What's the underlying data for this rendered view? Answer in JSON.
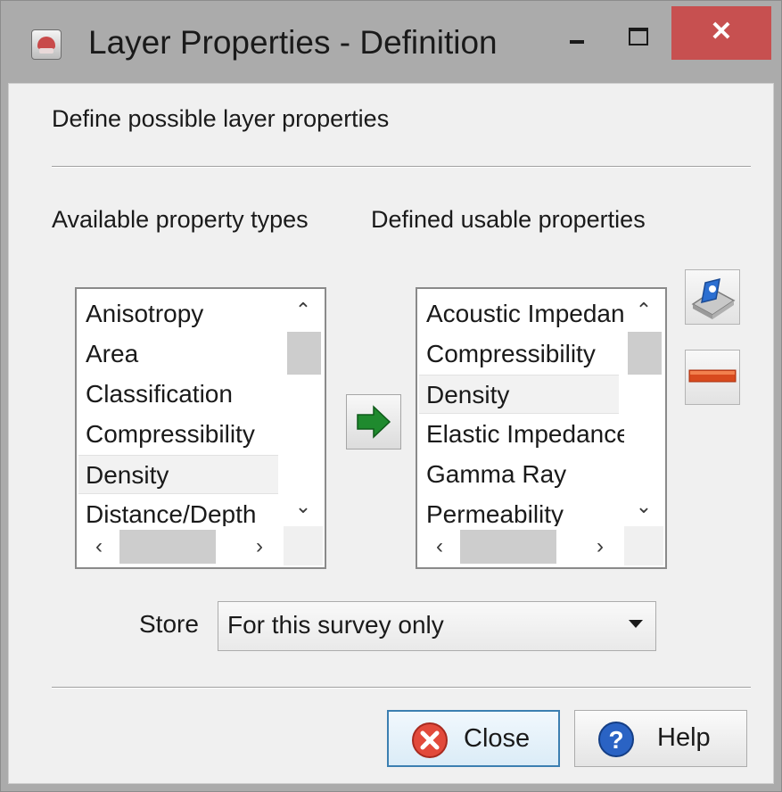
{
  "window": {
    "title": "Layer Properties - Definition",
    "close_glyph": "✕"
  },
  "heading": "Define possible layer properties",
  "available": {
    "label": "Available property types",
    "items": [
      "Anisotropy",
      "Area",
      "Classification",
      "Compressibility",
      "Density",
      "Distance/Depth"
    ],
    "selected": "Density"
  },
  "defined": {
    "label": "Defined usable properties",
    "items": [
      "Acoustic Impedance",
      "Compressibility",
      "Density",
      "Elastic Impedance",
      "Gamma Ray",
      "Permeability"
    ],
    "selected": "Density"
  },
  "scroll_glyphs": {
    "up": "⌃",
    "down": "⌄",
    "left": "‹",
    "right": "›"
  },
  "store": {
    "label": "Store",
    "value": "For this survey only"
  },
  "buttons": {
    "close": "Close",
    "help": "Help"
  },
  "icons": {
    "app": "app-icon",
    "add": "arrow-right-icon",
    "edit": "edit-property-icon",
    "remove": "minus-icon",
    "close": "close-circle-icon",
    "help": "help-icon"
  },
  "colors": {
    "titlebar": "#ababab",
    "close_button": "#c75050",
    "dialog_bg": "#f0f0f0",
    "arrow_green": "#1f8a2e",
    "minus_red": "#d84a1e",
    "default_button_border": "#3c7fb1"
  }
}
